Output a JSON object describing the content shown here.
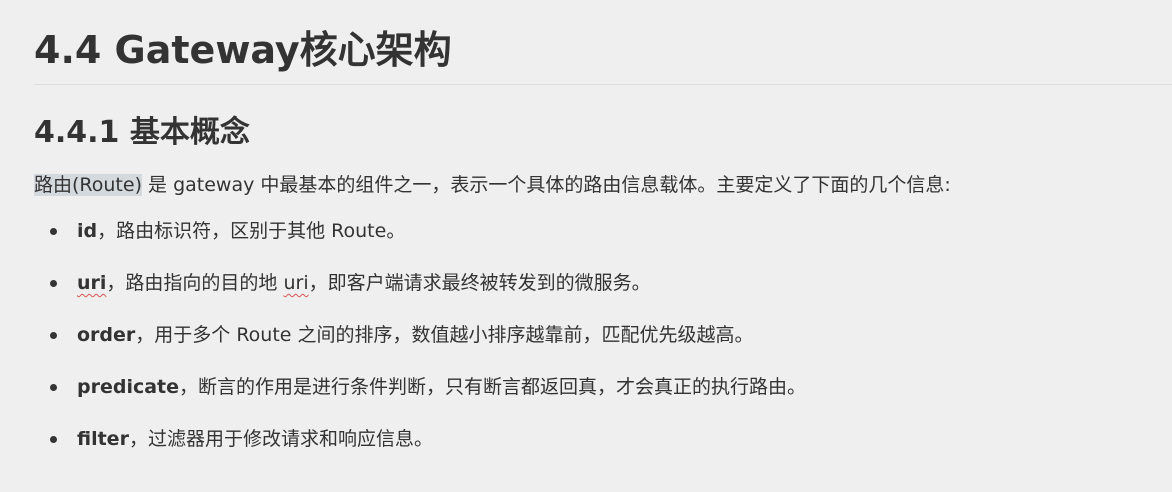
{
  "doc": {
    "h1": "4.4 Gateway核心架构",
    "h2": "4.4.1 基本概念",
    "intro_highlight": "路由(Route)",
    "intro_rest": " 是 gateway 中最基本的组件之一，表示一个具体的路由信息载体。主要定义了下面的几个信息:",
    "items": [
      {
        "term": "id",
        "parts": [
          "，路由标识符，区别于其他 Route。"
        ]
      },
      {
        "term": "uri",
        "parts": [
          "，路由指向的目的地 ",
          "uri",
          "，即客户端请求最终被转发到的微服务。"
        ]
      },
      {
        "term": "order",
        "parts": [
          "，用于多个 Route 之间的排序，数值越小排序越靠前，匹配优先级越高。"
        ]
      },
      {
        "term": "predicate",
        "parts": [
          "，断言的作用是进行条件判断，只有断言都返回真，才会真正的执行路由。"
        ]
      },
      {
        "term": "filter",
        "parts": [
          "，过滤器用于修改请求和响应信息。"
        ]
      }
    ]
  }
}
